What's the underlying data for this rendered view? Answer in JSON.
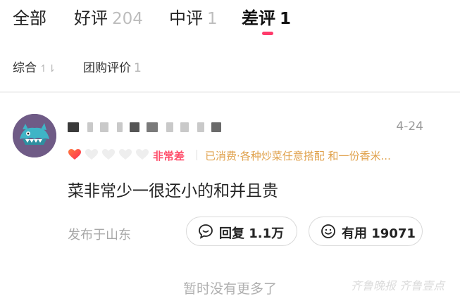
{
  "tabs": [
    {
      "label": "全部",
      "count": ""
    },
    {
      "label": "好评",
      "count": "204"
    },
    {
      "label": "中评",
      "count": "1"
    },
    {
      "label": "差评",
      "count": "1"
    }
  ],
  "sort": {
    "comprehensive_label": "综合",
    "comprehensive_icon": "↿⇂",
    "group_buy_label": "团购评价",
    "group_buy_count": "1"
  },
  "review": {
    "date": "4-24",
    "rating_text": "非常差",
    "hearts_filled": 1,
    "hearts_total": 5,
    "consumption": "已消费·各种炒菜任意搭配 和一份香米...",
    "content": "菜非常少一很还小的和并且贵",
    "location": "发布于山东",
    "reply_label": "回复 1.1万",
    "useful_label": "有用 19071"
  },
  "footer": {
    "no_more": "暂时没有更多了",
    "watermark": "齐鲁晚报 齐鲁壹点"
  },
  "colors": {
    "accent": "#ff3b6b",
    "rating_text": "#ff4d6a",
    "consumption": "#e0a24d",
    "muted": "#a8a8a8"
  },
  "icons": {
    "heart": "heart-icon",
    "reply": "comment-icon",
    "useful": "smile-icon",
    "sort": "sort-icon"
  }
}
